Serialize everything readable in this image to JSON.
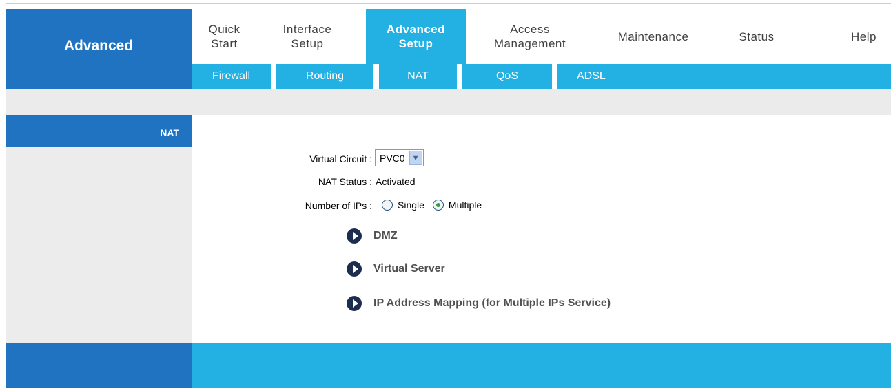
{
  "brand": {
    "title": "Advanced"
  },
  "main_nav": [
    {
      "line1": "Quick",
      "line2": "Start",
      "active": false
    },
    {
      "line1": "Interface",
      "line2": "Setup",
      "active": false
    },
    {
      "line1": "Advanced",
      "line2": "Setup",
      "active": true
    },
    {
      "line1": "Access",
      "line2": "Management",
      "active": false
    },
    {
      "line1": "Maintenance",
      "line2": "",
      "active": false
    },
    {
      "line1": "Status",
      "line2": "",
      "active": false
    },
    {
      "line1": "Help",
      "line2": "",
      "active": false
    }
  ],
  "sub_nav": [
    "Firewall",
    "Routing",
    "NAT",
    "QoS",
    "ADSL"
  ],
  "sidebar": {
    "section_title": "NAT"
  },
  "form": {
    "virtual_circuit_label": "Virtual Circuit :",
    "virtual_circuit_value": "PVC0",
    "nat_status_label": "NAT Status :",
    "nat_status_value": "Activated",
    "num_ips_label": "Number of IPs :",
    "option_single": "Single",
    "option_multiple": "Multiple",
    "selected_option": "Multiple"
  },
  "links": [
    {
      "label": "DMZ"
    },
    {
      "label": "Virtual Server"
    },
    {
      "label": "IP Address Mapping (for Multiple IPs Service)"
    }
  ],
  "colors": {
    "dark_blue": "#1f73c1",
    "light_blue": "#23b0e3",
    "grey": "#ebebeb"
  }
}
